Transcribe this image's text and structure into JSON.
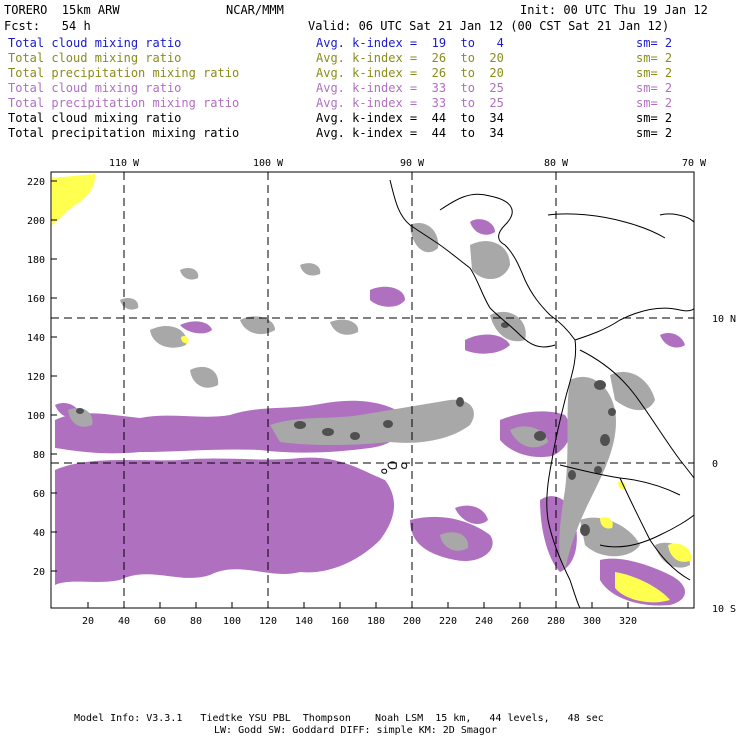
{
  "header": {
    "title_left": "TORERO  15km ARW",
    "center": "NCAR/MMM",
    "init": "Init: 00 UTC Thu 19 Jan 12",
    "fcst": "Fcst:   54 h",
    "valid": "Valid: 06 UTC Sat 21 Jan 12 (00 CST Sat 21 Jan 12)"
  },
  "legend": [
    {
      "label": "Total cloud mixing ratio",
      "avg": "Avg. k-index =  19  to   4",
      "sm": "sm= 2",
      "color": "#1a1acc"
    },
    {
      "label": "Total cloud mixing ratio",
      "avg": "Avg. k-index =  26  to  20",
      "sm": "sm= 2",
      "color": "#8c8c1a"
    },
    {
      "label": "Total precipitation mixing ratio",
      "avg": "Avg. k-index =  26  to  20",
      "sm": "sm= 2",
      "color": "#8c8c1a"
    },
    {
      "label": "Total cloud mixing ratio",
      "avg": "Avg. k-index =  33  to  25",
      "sm": "sm= 2",
      "color": "#b070c0"
    },
    {
      "label": "Total precipitation mixing ratio",
      "avg": "Avg. k-index =  33  to  25",
      "sm": "sm= 2",
      "color": "#b070c0"
    },
    {
      "label": "Total cloud mixing ratio",
      "avg": "Avg. k-index =  44  to  34",
      "sm": "sm= 2",
      "color": "#000000"
    },
    {
      "label": "Total precipitation mixing ratio",
      "avg": "Avg. k-index =  44  to  34",
      "sm": "sm= 2",
      "color": "#000000"
    }
  ],
  "map": {
    "lon_labels": [
      "110 W",
      "100 W",
      "90 W",
      "80 W",
      "70 W"
    ],
    "lat_labels": [
      "10 N",
      "0",
      "10 S"
    ],
    "x_ticks": [
      "20",
      "40",
      "60",
      "80",
      "100",
      "120",
      "140",
      "160",
      "180",
      "200",
      "220",
      "240",
      "260",
      "280",
      "300",
      "320"
    ],
    "y_ticks": [
      "220",
      "200",
      "180",
      "160",
      "140",
      "120",
      "100",
      "80",
      "60",
      "40",
      "20"
    ],
    "colors": {
      "purple": "#b070c0",
      "gray": "#a8a8a8",
      "dark_gray": "#505050",
      "yellow": "#ffff50",
      "black_line": "#000000"
    }
  },
  "footer": {
    "line1": "Model Info: V3.3.1   Tiedtke YSU PBL  Thompson    Noah LSM  15 km,   44 levels,   48 sec",
    "line2": "LW: Godd SW: Goddard DIFF: simple KM: 2D Smagor"
  }
}
